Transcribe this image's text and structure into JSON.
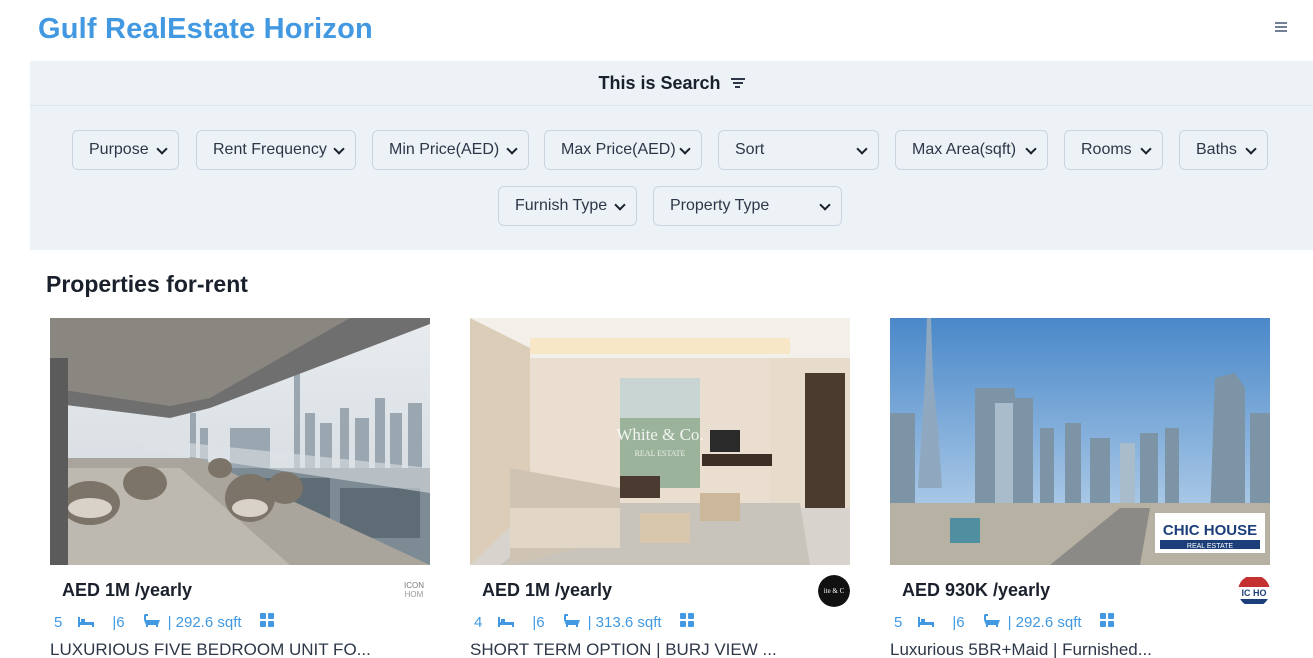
{
  "header": {
    "brand": "Gulf RealEstate Horizon",
    "menu_icon": "hamburger-menu-icon"
  },
  "search": {
    "title": "This is Search",
    "filters": [
      "Purpose",
      "Rent Frequency",
      "Min Price(AED)",
      "Max Price(AED)",
      "Sort",
      "Max Area(sqft)",
      "Rooms",
      "Baths",
      "Furnish Type",
      "Property Type"
    ]
  },
  "section": {
    "title": "Properties for-rent"
  },
  "listings": [
    {
      "price": "AED 1M /yearly",
      "rooms": "5",
      "baths": "|6",
      "area": "| 292.6 sqft",
      "title": "LUXURIOUS FIVE BEDROOM UNIT FO...",
      "agency_logo_text": "ICON HOMES"
    },
    {
      "price": "AED 1M /yearly",
      "rooms": "4",
      "baths": "|6",
      "area": "| 313.6 sqft",
      "title": "SHORT TERM OPTION | BURJ VIEW ...",
      "agency_logo_text": "White & Co."
    },
    {
      "price": "AED 930K /yearly",
      "rooms": "5",
      "baths": "|6",
      "area": "| 292.6 sqft",
      "title": "Luxurious 5BR+Maid | Furnished...",
      "agency_logo_text": "CHIC HOUSE"
    }
  ],
  "colors": {
    "brand": "#4299e1",
    "panel": "#edf2f7",
    "accent": "#4299e1"
  }
}
